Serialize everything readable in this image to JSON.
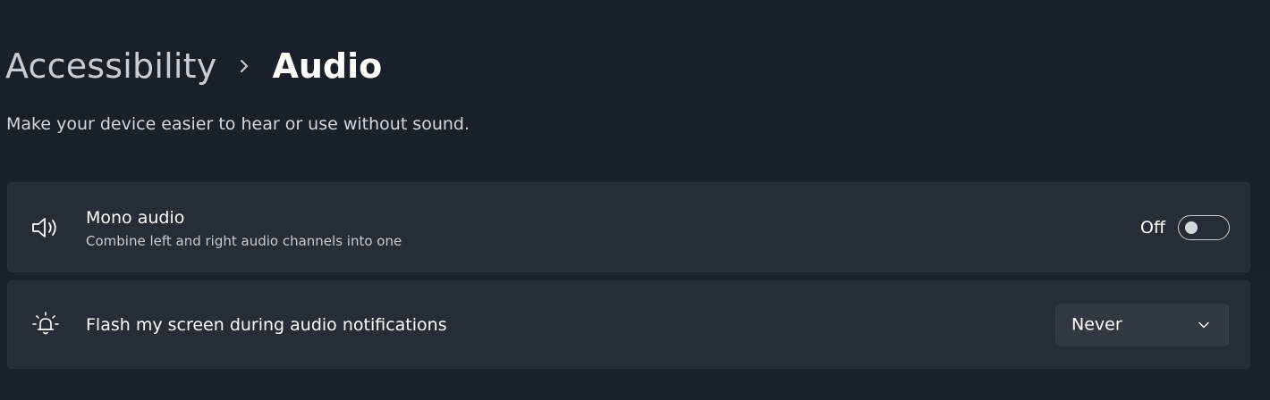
{
  "breadcrumb": {
    "parent": "Accessibility",
    "current": "Audio",
    "separator_icon": "chevron-right-icon"
  },
  "subtitle": "Make your device easier to hear or use without sound.",
  "settings": [
    {
      "id": "mono-audio",
      "icon": "speaker-icon",
      "title": "Mono audio",
      "description": "Combine left and right audio channels into one",
      "control": "toggle",
      "state_label": "Off",
      "state_on": false
    },
    {
      "id": "flash-screen",
      "icon": "bell-flash-icon",
      "title": "Flash my screen during audio notifications",
      "control": "dropdown",
      "selected": "Never",
      "chevron_icon": "chevron-down-icon"
    }
  ],
  "colors": {
    "background": "#1b212a",
    "card": "#272d36",
    "dropdown": "#323842",
    "text_primary": "#ffffff",
    "text_secondary": "#c7cbd1"
  }
}
